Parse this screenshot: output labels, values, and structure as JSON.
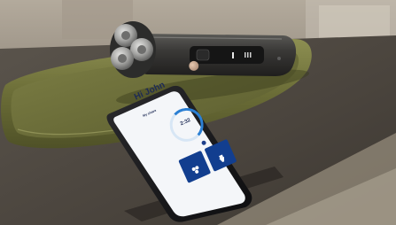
{
  "phone_app": {
    "greeting": "Hi John",
    "sub_greeting": "",
    "section_label": "My shave",
    "section_sub": "",
    "ring_value": "2:32",
    "ring_unit": "",
    "info_text": "",
    "top_label": "",
    "tiles": [
      {
        "label": ""
      },
      {
        "label": ""
      }
    ]
  },
  "shaver": {
    "brand_mark": "",
    "button_label": ""
  },
  "colors": {
    "tray": "#6d6f3a",
    "counter": "#4b4640",
    "shaver_body": "#2f2e2c",
    "app_accent": "#2b7fd3",
    "tile_blue": "#123e8f"
  }
}
